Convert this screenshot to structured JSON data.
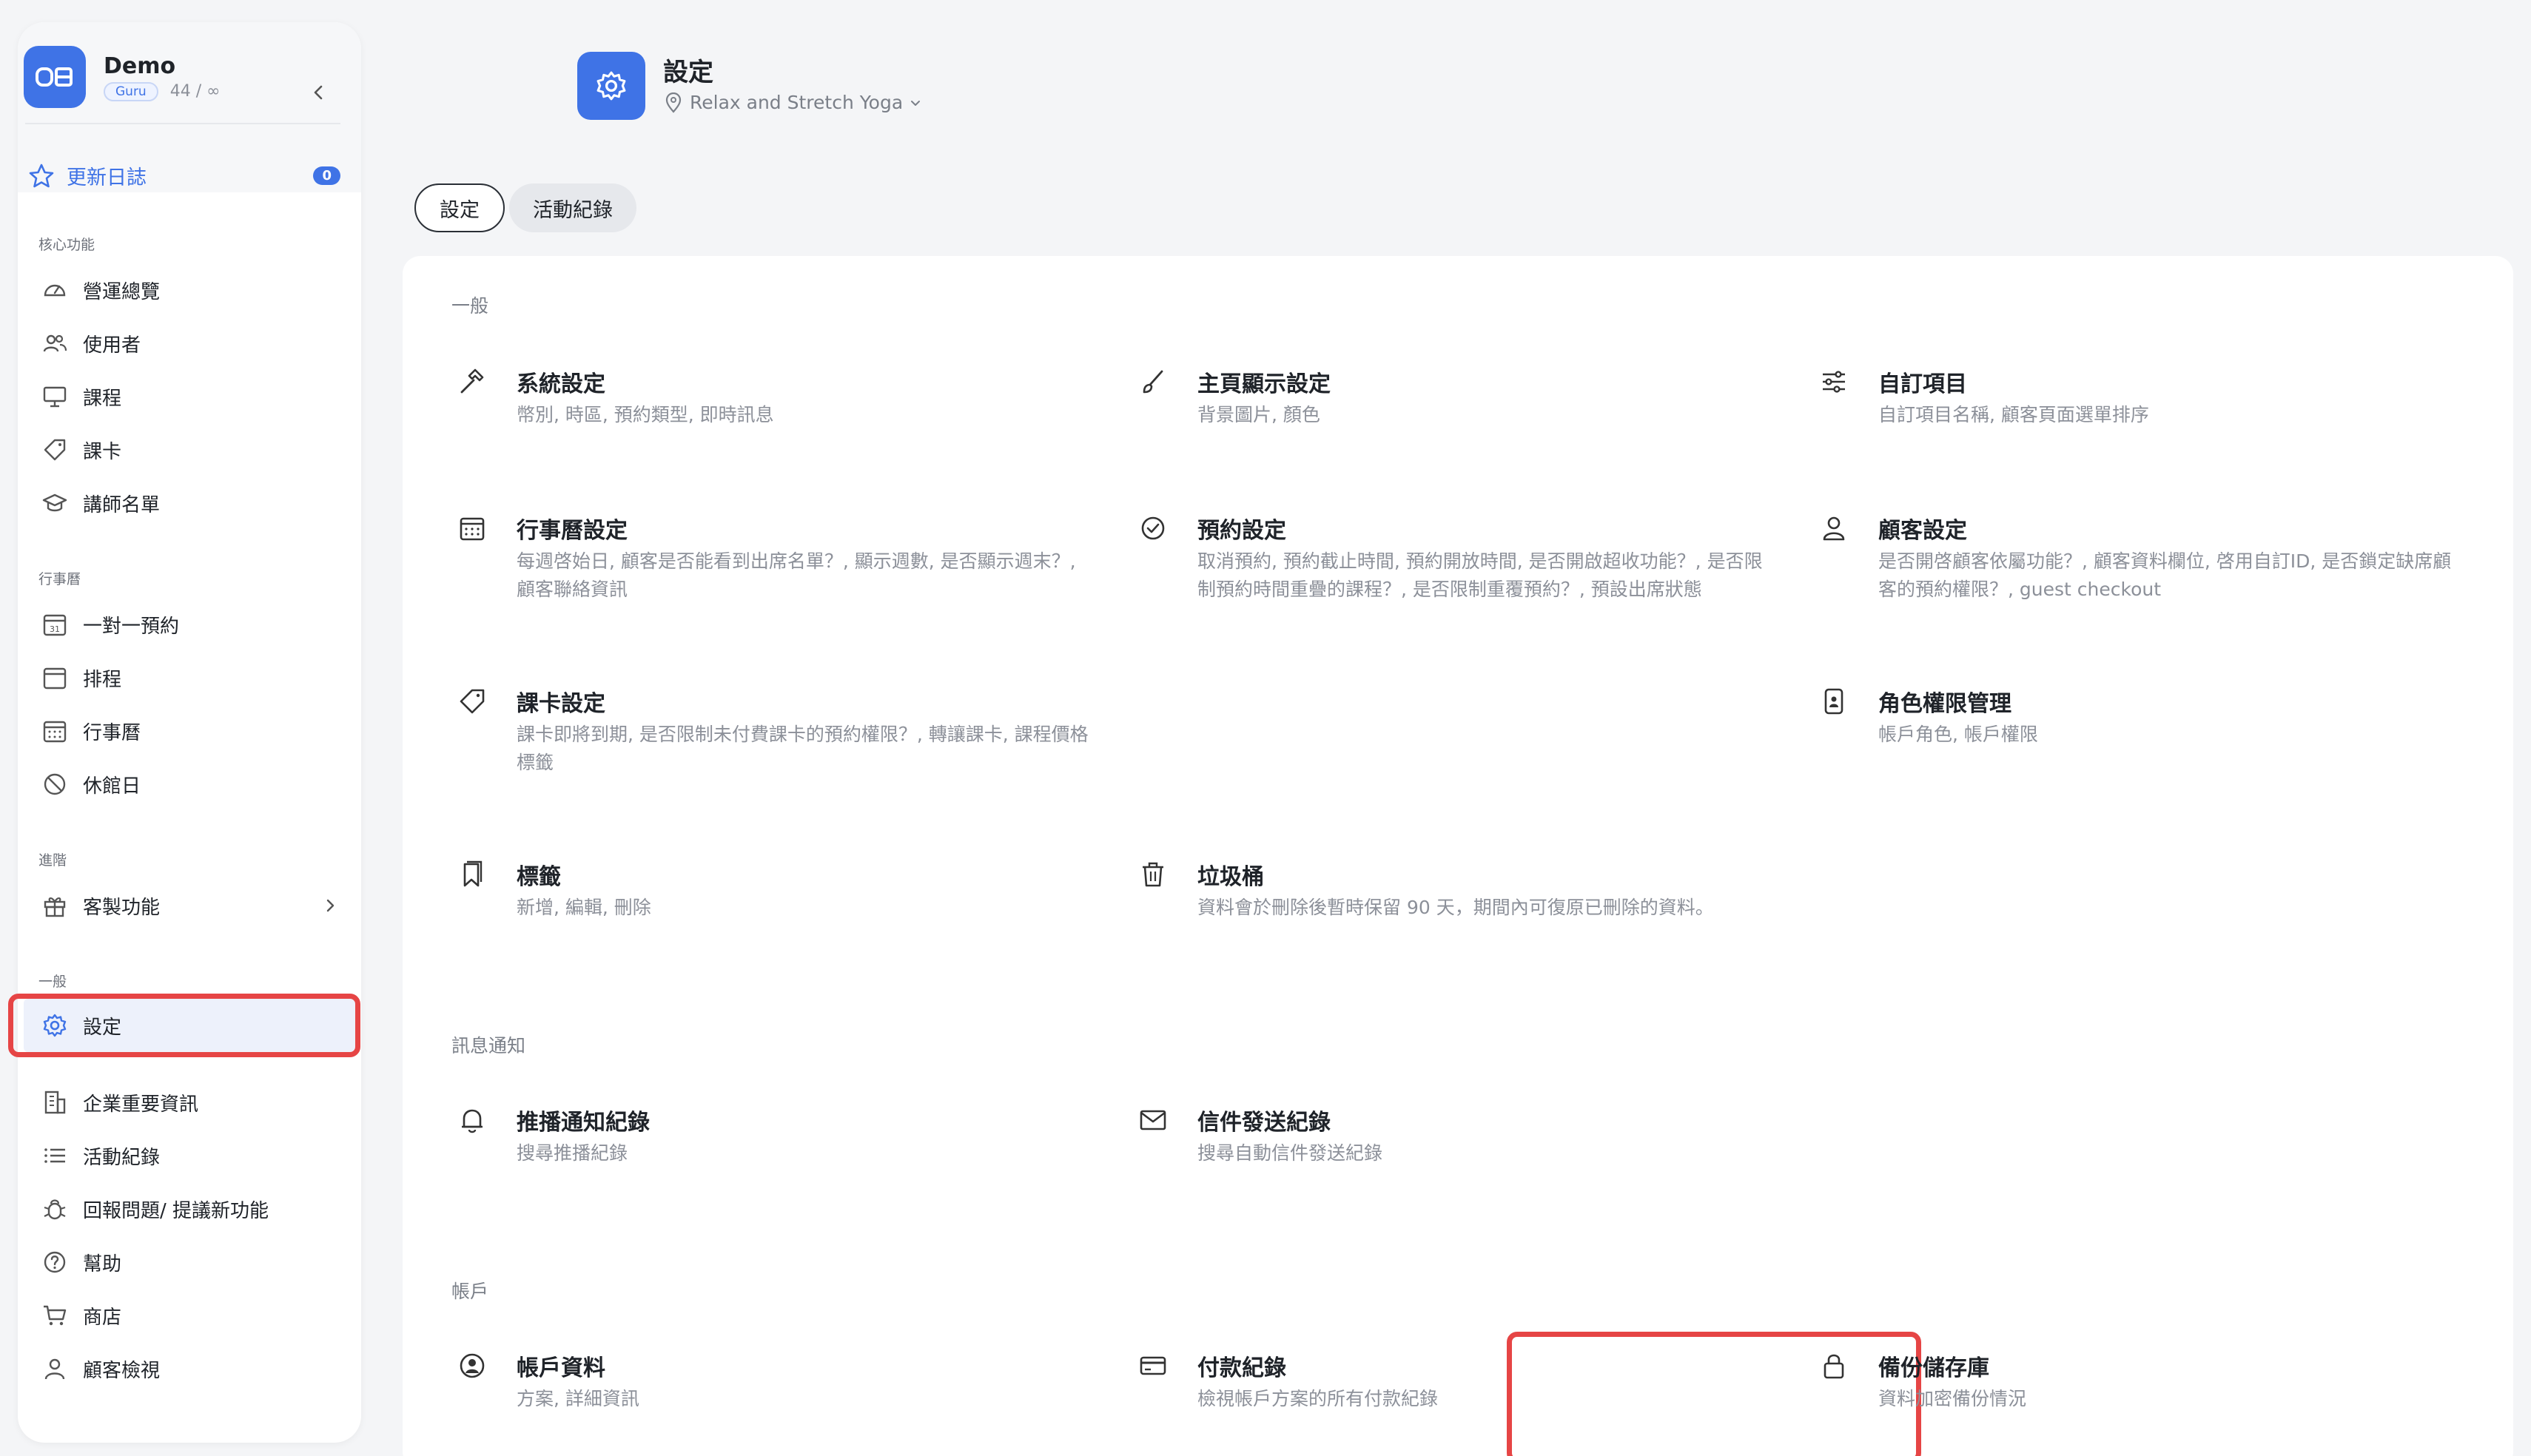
{
  "sidebar": {
    "brand_name": "Demo",
    "plan_badge": "Guru",
    "usage": "44 / ∞",
    "changelog_label": "更新日誌",
    "changelog_count": "0",
    "sections": {
      "core": "核心功能",
      "calendar": "行事曆",
      "advanced": "進階",
      "general": "一般"
    },
    "items": {
      "overview": "營運總覽",
      "users": "使用者",
      "courses": "課程",
      "class_cards": "課卡",
      "instructors": "講師名單",
      "one_on_one": "一對一預約",
      "schedule": "排程",
      "calendar": "行事曆",
      "closed_days": "休館日",
      "custom_features": "客製功能",
      "settings": "設定",
      "company_info": "企業重要資訊",
      "activity_log": "活動紀錄",
      "report_issue": "回報問題/ 提議新功能",
      "help": "幫助",
      "shop": "商店",
      "customer_view": "顧客檢視"
    }
  },
  "header": {
    "title": "設定",
    "location": "Relax and Stretch Yoga"
  },
  "tabs": {
    "settings": "設定",
    "activity_log": "活動紀錄"
  },
  "groups": {
    "general": "一般",
    "notifications": "訊息通知",
    "account": "帳戶"
  },
  "items": {
    "system": {
      "title": "系統設定",
      "desc": "幣別, 時區, 預約類型, 即時訊息"
    },
    "homepage": {
      "title": "主頁顯示設定",
      "desc": "背景圖片, 顏色"
    },
    "custom_items": {
      "title": "自訂項目",
      "desc": "自訂項目名稱, 顧客頁面選單排序"
    },
    "calendar": {
      "title": "行事曆設定",
      "desc": "每週啓始日, 顧客是否能看到出席名單？, 顯示週數, 是否顯示週末？, 顧客聯絡資訊"
    },
    "booking": {
      "title": "預約設定",
      "desc": "取消預約, 預約截止時間, 預約開放時間, 是否開啟超收功能？, 是否限制預約時間重疊的課程？, 是否限制重覆預約？, 預設出席狀態"
    },
    "customer": {
      "title": "顧客設定",
      "desc": "是否開啓顧客依屬功能？, 顧客資料欄位, 啓用自訂ID, 是否鎖定缺席顧客的預約權限？, guest checkout"
    },
    "class_card": {
      "title": "課卡設定",
      "desc": "課卡即將到期, 是否限制未付費課卡的預約權限？, 轉讓課卡, 課程價格標籤"
    },
    "roles": {
      "title": "角色權限管理",
      "desc": "帳戶角色, 帳戶權限"
    },
    "tags": {
      "title": "標籤",
      "desc": "新增, 編輯, 刪除"
    },
    "trash": {
      "title": "垃圾桶",
      "desc": "資料會於刪除後暫時保留 90 天，期間內可復原已刪除的資料。"
    },
    "push_log": {
      "title": "推播通知紀錄",
      "desc": "搜尋推播紀錄"
    },
    "mail_log": {
      "title": "信件發送紀錄",
      "desc": "搜尋自動信件發送紀錄"
    },
    "account_info": {
      "title": "帳戶資料",
      "desc": "方案, 詳細資訊"
    },
    "payment_log": {
      "title": "付款紀錄",
      "desc": "檢視帳戶方案的所有付款紀錄"
    },
    "backup": {
      "title": "備份儲存庫",
      "desc": "資料加密備份情況"
    }
  },
  "colors": {
    "accent": "#3f73e6",
    "highlight": "#e64545"
  }
}
